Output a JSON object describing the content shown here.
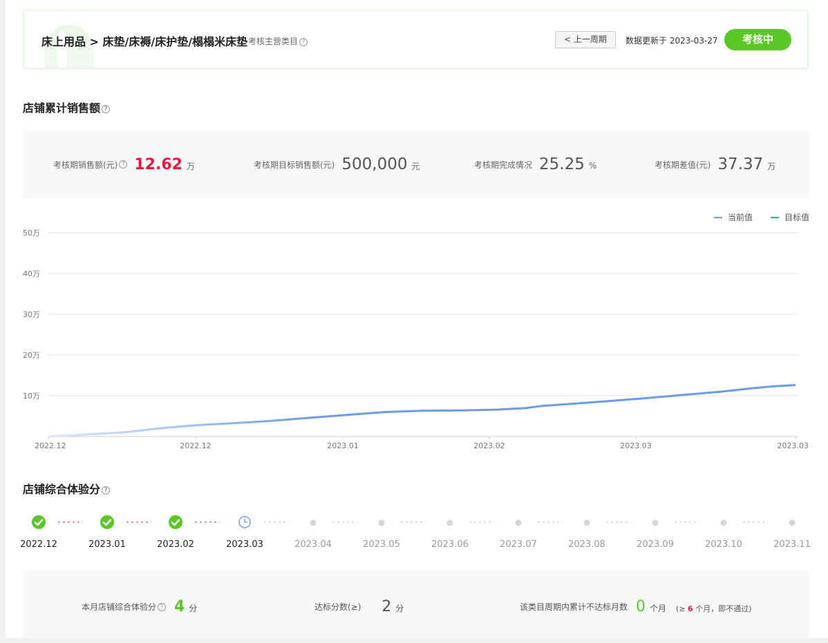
{
  "header": {
    "category": "床上用品 > 床垫/床褥/床护垫/榻榻米床垫",
    "category_hint": "考核主营类目",
    "prev_period": "< 上一周期",
    "updated": "数据更新于 2023-03-27",
    "status": "考核中"
  },
  "sales_section": {
    "title": "店铺累计销售额",
    "stats": [
      {
        "label": "考核期销售额(元)",
        "value": "12.62",
        "unit": "万"
      },
      {
        "label": "考核期目标销售额(元)",
        "value": "500,000",
        "unit": "元"
      },
      {
        "label": "考核期完成情况",
        "value": "25.25",
        "unit": "%"
      },
      {
        "label": "考核期差值(元)",
        "value": "37.37",
        "unit": "万"
      }
    ]
  },
  "chart_data": {
    "type": "line",
    "x_ticks": [
      "2022.12",
      "2022.12",
      "2023.01",
      "2023.02",
      "2023.03",
      "2023.03"
    ],
    "y_ticks": [
      "10万",
      "20万",
      "30万",
      "40万",
      "50万"
    ],
    "ylim": [
      0,
      50
    ],
    "series": [
      {
        "name": "当前值",
        "color": "#6b9bea",
        "x": [
          0,
          0.05,
          0.1,
          0.16,
          0.2,
          0.27,
          0.31,
          0.35,
          0.4,
          0.45,
          0.5,
          0.55,
          0.6,
          0.64,
          0.66,
          0.7,
          0.75,
          0.8,
          0.85,
          0.9,
          0.94,
          0.97,
          1.0
        ],
        "values": [
          0,
          0.5,
          1.0,
          2.2,
          2.8,
          3.5,
          4.0,
          4.6,
          5.3,
          6.0,
          6.3,
          6.4,
          6.6,
          7.0,
          7.5,
          8.0,
          8.7,
          9.4,
          10.2,
          11.0,
          11.8,
          12.3,
          12.62
        ]
      },
      {
        "name": "目标值",
        "color": "#19c18a",
        "x": [
          0,
          1.0
        ],
        "values": [
          50,
          50
        ]
      }
    ],
    "legend": "top-right",
    "grid": true
  },
  "experience_section": {
    "title": "店铺综合体验分",
    "timeline": [
      {
        "label": "2022.12",
        "state": "done"
      },
      {
        "label": "2023.01",
        "state": "done"
      },
      {
        "label": "2023.02",
        "state": "done"
      },
      {
        "label": "2023.03",
        "state": "current"
      },
      {
        "label": "2023.04",
        "state": "future"
      },
      {
        "label": "2023.05",
        "state": "future"
      },
      {
        "label": "2023.06",
        "state": "future"
      },
      {
        "label": "2023.07",
        "state": "future"
      },
      {
        "label": "2023.08",
        "state": "future"
      },
      {
        "label": "2023.09",
        "state": "future"
      },
      {
        "label": "2023.10",
        "state": "future"
      },
      {
        "label": "2023.11",
        "state": "future"
      }
    ],
    "score": {
      "label": "本月店铺综合体验分",
      "value": "4",
      "unit": "分"
    },
    "threshold": {
      "label": "达标分数(≥)",
      "value": "2",
      "unit": "分"
    },
    "fail_months": {
      "label": "该类目周期内累计不达标月数",
      "value": "0",
      "unit": "个月",
      "note_prefix": "(≥",
      "note_num": "6",
      "note_suffix": "个月，即不通过)"
    }
  },
  "colors": {
    "accent_green": "#5ac728",
    "red": "#e8173f",
    "line_blue": "#6b9bea",
    "target_green": "#19c18a",
    "dot_red": "#e95b6b"
  }
}
